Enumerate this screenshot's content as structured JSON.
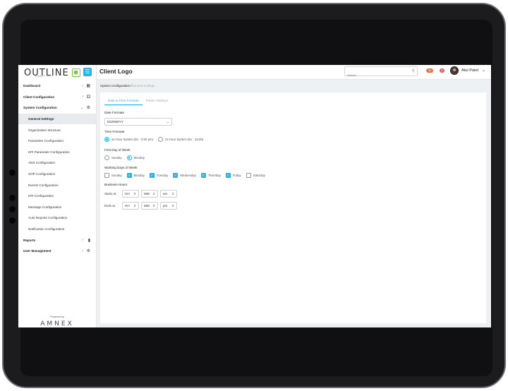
{
  "brand": {
    "name": "OUTLINE",
    "sub": "SMART CITY"
  },
  "sidebar": {
    "items": [
      {
        "label": "Dashboard",
        "icon": "grid-icon"
      },
      {
        "label": "Client Configuration",
        "icon": "people-icon"
      },
      {
        "label": "System Configuration",
        "icon": "people-gear-icon"
      },
      {
        "label": "General Settings"
      },
      {
        "label": "Organization Structure"
      },
      {
        "label": "Parameter Configuration"
      },
      {
        "label": "KPI Parameter Configuration"
      },
      {
        "label": "Alert Configuration"
      },
      {
        "label": "SOP Configuration"
      },
      {
        "label": "Events Configuration"
      },
      {
        "label": "KPI Configuration"
      },
      {
        "label": "Message Configuration"
      },
      {
        "label": "Auto Reports Configuration"
      },
      {
        "label": "Notification Configuration"
      },
      {
        "label": "Reports",
        "icon": "bar-chart-icon"
      },
      {
        "label": "User Management",
        "icon": "user-gear-icon"
      }
    ],
    "powered_by": "Powered by",
    "vendor": "AMNEX"
  },
  "header": {
    "title": "Client Logo",
    "search_placeholder": "Search",
    "badge_alerts": "99",
    "badge_notifications": "2",
    "user_name": "Atul Patel"
  },
  "breadcrumb": {
    "parent": "System Configuration /",
    "current": "General Settings"
  },
  "tabs": [
    {
      "label": "Date & Time Formate"
    },
    {
      "label": "Public Holidays"
    }
  ],
  "form": {
    "date_format_label": "Date Formate",
    "date_format_value": "DD/MM/YY",
    "time_format_label": "Time Formate",
    "time_12": "12 Hour System (Ex : 3:00 pm)",
    "time_24": "24 Hour System (Ex : 15:00)",
    "first_day_label": "First Day of Week",
    "first_sunday": "Sunday",
    "first_monday": "Monday",
    "working_days_label": "Working Days of Week",
    "days": [
      "Sunday",
      "Monday",
      "Tuesday",
      "Wednesday",
      "Thursday",
      "Friday",
      "Saturday"
    ],
    "business_hours_label": "Business Hours",
    "starts_at": "Starts at",
    "ends_at": "Ends at",
    "hh": "HH",
    "mm": "MM",
    "am": "am",
    "pm": "pm"
  },
  "colors": {
    "accent": "#2ab4e6",
    "brand_green": "#7ac943"
  }
}
